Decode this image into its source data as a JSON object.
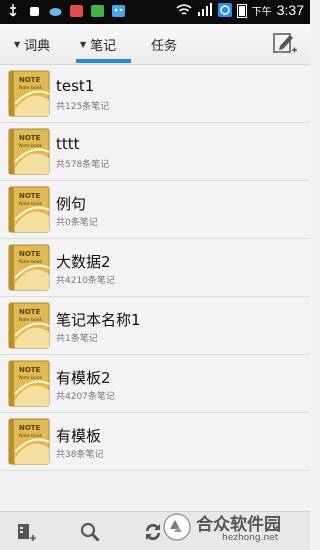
{
  "status": {
    "ampm": "下午",
    "time": "3:37"
  },
  "tabs": [
    {
      "label": "词典",
      "has_dropdown": true
    },
    {
      "label": "笔记",
      "has_dropdown": true,
      "active": true
    },
    {
      "label": "任务",
      "has_dropdown": false
    }
  ],
  "notebooks": [
    {
      "title": "test1",
      "count": "共125条笔记"
    },
    {
      "title": "tttt",
      "count": "共578条笔记"
    },
    {
      "title": "例句",
      "count": "共0条笔记"
    },
    {
      "title": "大数据2",
      "count": "共4210条笔记"
    },
    {
      "title": "笔记本名称1",
      "count": "共1条笔记"
    },
    {
      "title": "有模板2",
      "count": "共4207条笔记"
    },
    {
      "title": "有模板",
      "count": "共38条笔记"
    }
  ],
  "icon_text": {
    "line1": "NOTE",
    "line2": "Note book"
  },
  "watermark": {
    "text": "合众软件园",
    "url": "hezhong.net"
  },
  "colors": {
    "accent": "#1e8fd6",
    "notebook_gold": "#d9b24a"
  }
}
